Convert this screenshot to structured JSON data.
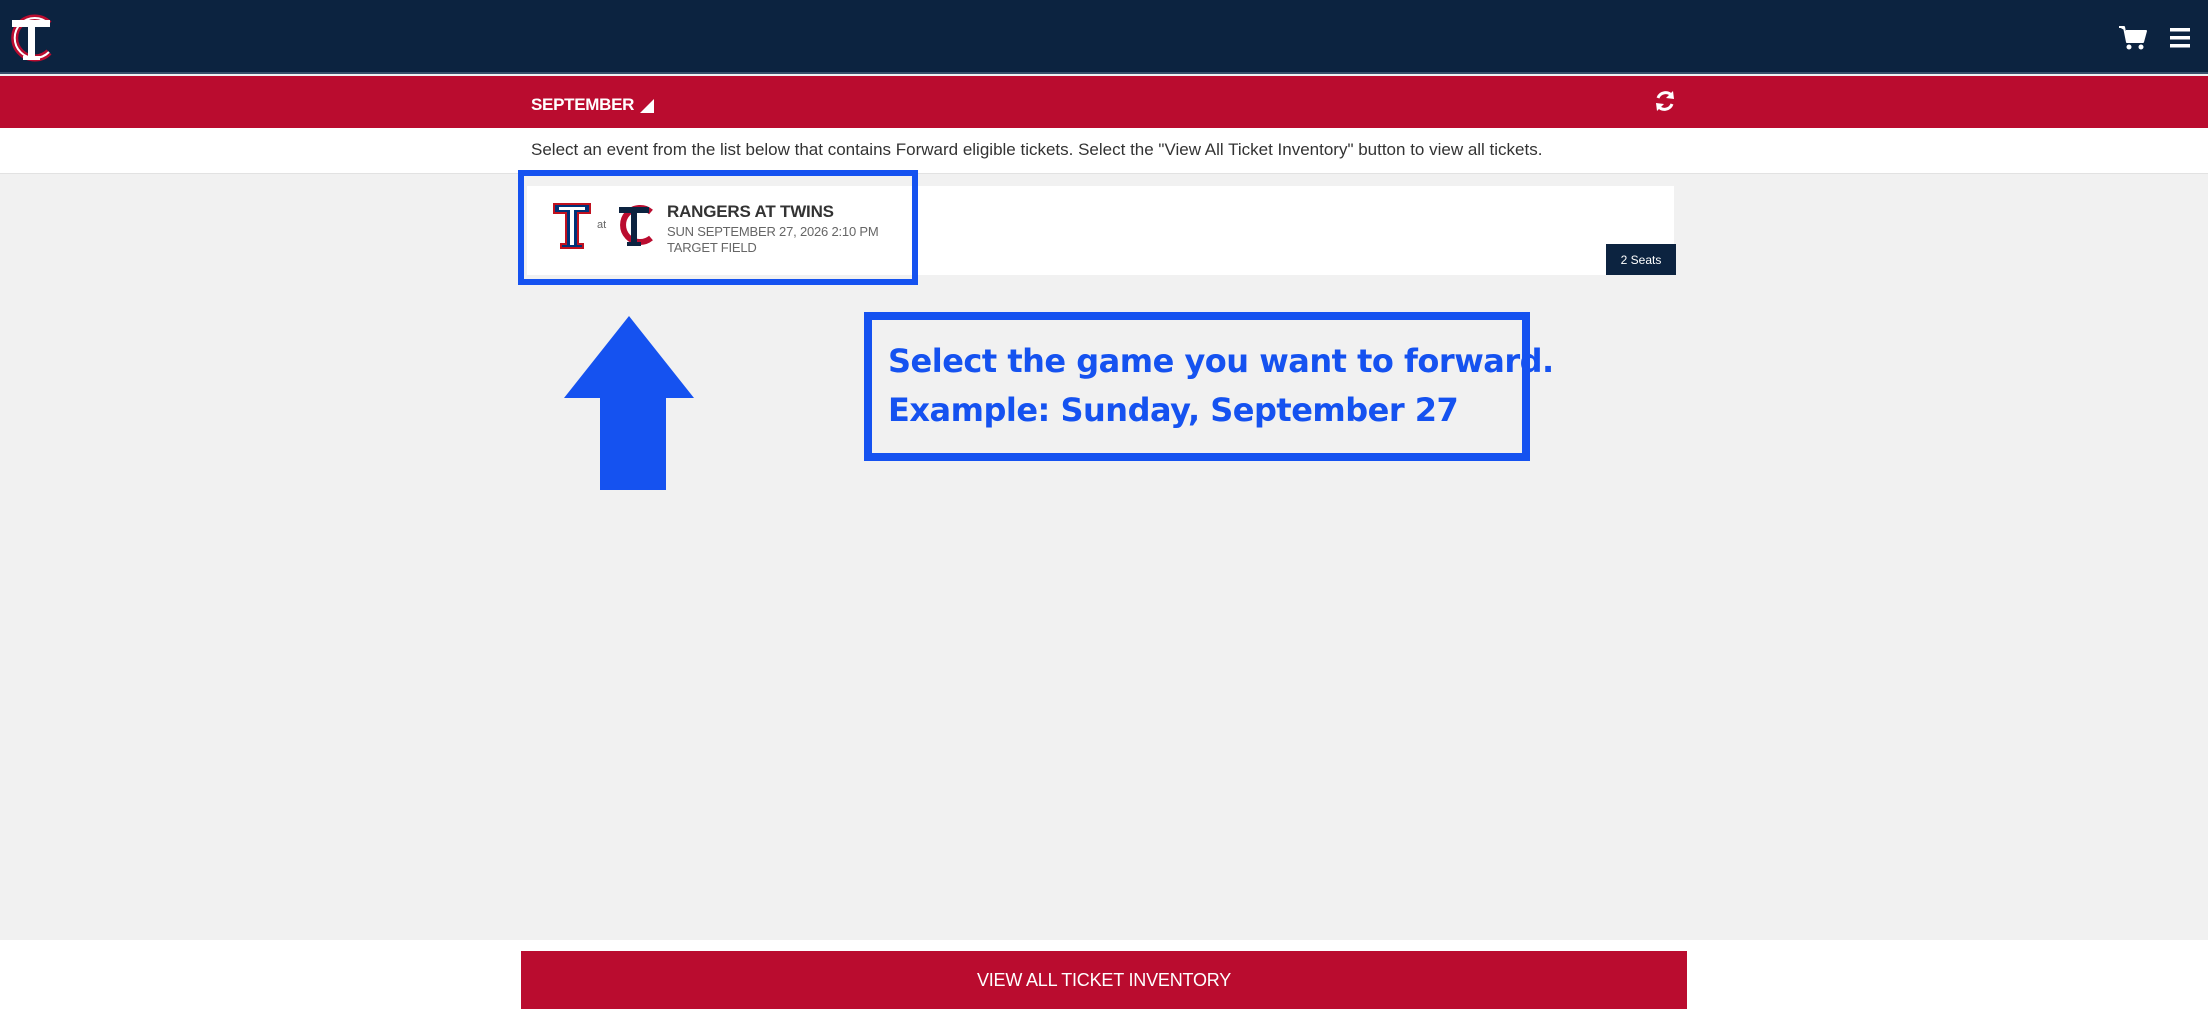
{
  "header": {
    "logo_icon": "twins-tc-logo",
    "cart_icon": "cart-icon",
    "menu_icon": "hamburger-menu-icon"
  },
  "month_bar": {
    "selected_month": "SEPTEMBER",
    "refresh_icon": "refresh-icon"
  },
  "instructions": {
    "text": "Select an event from the list below that contains Forward eligible tickets. Select the \"View All Ticket Inventory\" button to view all tickets."
  },
  "events": [
    {
      "away_logo": "rangers-t-logo",
      "at_label": "at",
      "home_logo": "twins-tc-logo",
      "title": "RANGERS AT TWINS",
      "date": "SUN SEPTEMBER 27, 2026 2:10 PM",
      "venue": "TARGET FIELD",
      "seats_badge": "2 Seats"
    }
  ],
  "annotation": {
    "line1": "Select the game you want to forward.",
    "line2": "Example: Sunday, September 27",
    "color": "#1552f0"
  },
  "footer": {
    "view_all_label": "VIEW ALL TICKET INVENTORY"
  },
  "colors": {
    "navy": "#0c2340",
    "red": "#ba0c2f"
  }
}
